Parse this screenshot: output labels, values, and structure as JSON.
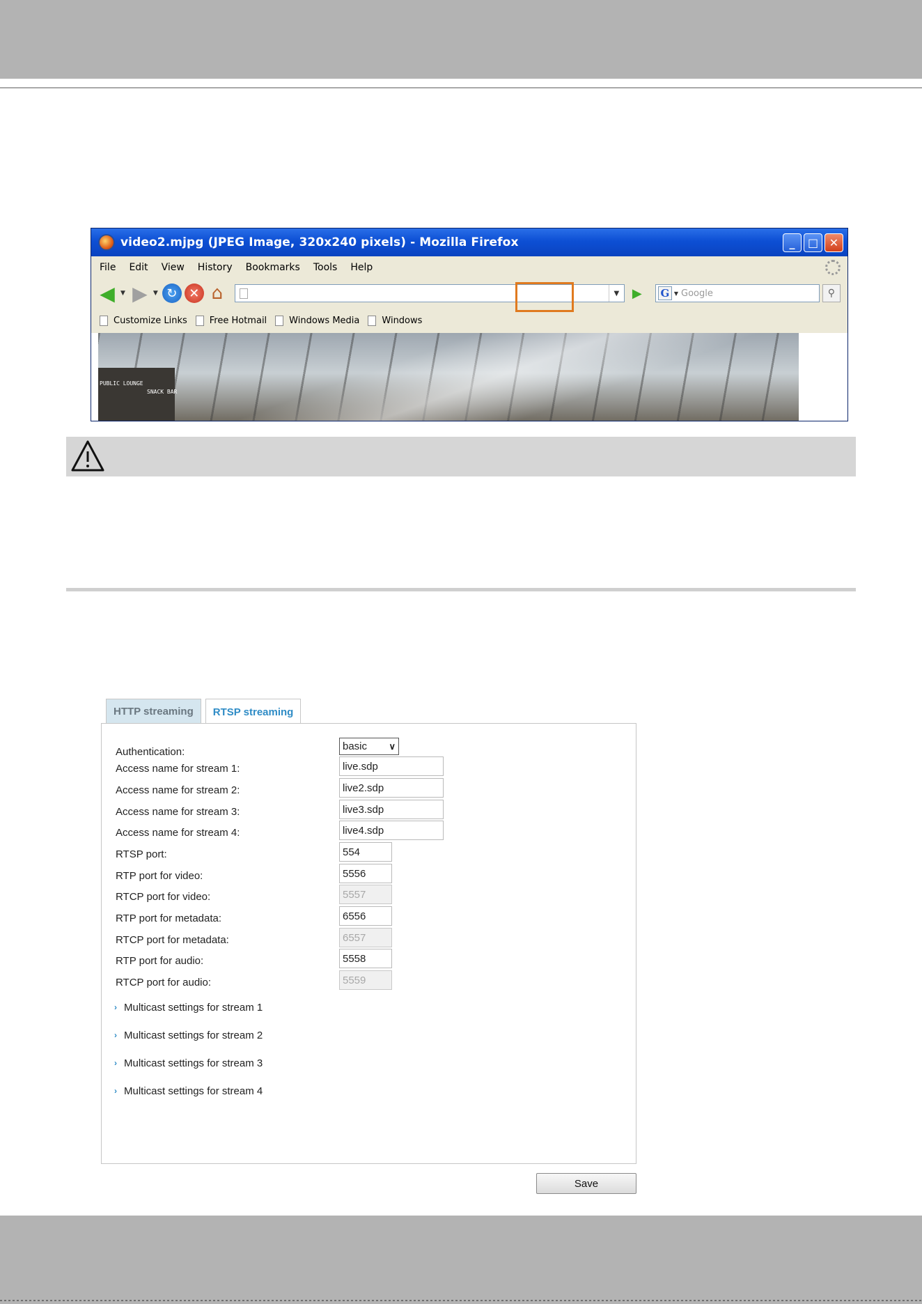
{
  "firefox": {
    "title": "video2.mjpg (JPEG Image, 320x240 pixels) - Mozilla Firefox",
    "menu": [
      "File",
      "Edit",
      "View",
      "History",
      "Bookmarks",
      "Tools",
      "Help"
    ],
    "search_placeholder": "Google",
    "bookmarks": [
      "Customize Links",
      "Free Hotmail",
      "Windows Media",
      "Windows"
    ],
    "photo_signs": [
      "PUBLIC LOUNGE",
      "SNACK BAR"
    ],
    "highlight_color": "#e07a1f"
  },
  "rtsp": {
    "tabs": [
      "HTTP streaming",
      "RTSP streaming"
    ],
    "authentication": {
      "label": "Authentication:",
      "value": "basic"
    },
    "fields": [
      {
        "label": "Access name for stream 1:",
        "value": "live.sdp",
        "disabled": false
      },
      {
        "label": "Access name for stream 2:",
        "value": "live2.sdp",
        "disabled": false
      },
      {
        "label": "Access name for stream 3:",
        "value": "live3.sdp",
        "disabled": false
      },
      {
        "label": "Access name for stream 4:",
        "value": "live4.sdp",
        "disabled": false
      },
      {
        "label": "RTSP port:",
        "value": "554",
        "disabled": false
      },
      {
        "label": "RTP port for video:",
        "value": "5556",
        "disabled": false
      },
      {
        "label": "RTCP port for video:",
        "value": "5557",
        "disabled": true
      },
      {
        "label": "RTP port for metadata:",
        "value": "6556",
        "disabled": false
      },
      {
        "label": "RTCP port for metadata:",
        "value": "6557",
        "disabled": true
      },
      {
        "label": "RTP port for audio:",
        "value": "5558",
        "disabled": false
      },
      {
        "label": "RTCP port for audio:",
        "value": "5559",
        "disabled": true
      }
    ],
    "multicast": [
      "Multicast settings for stream 1",
      "Multicast settings for stream 2",
      "Multicast settings for stream 3",
      "Multicast settings for stream 4"
    ],
    "save_label": "Save",
    "accent_color": "#2f8cc6"
  }
}
